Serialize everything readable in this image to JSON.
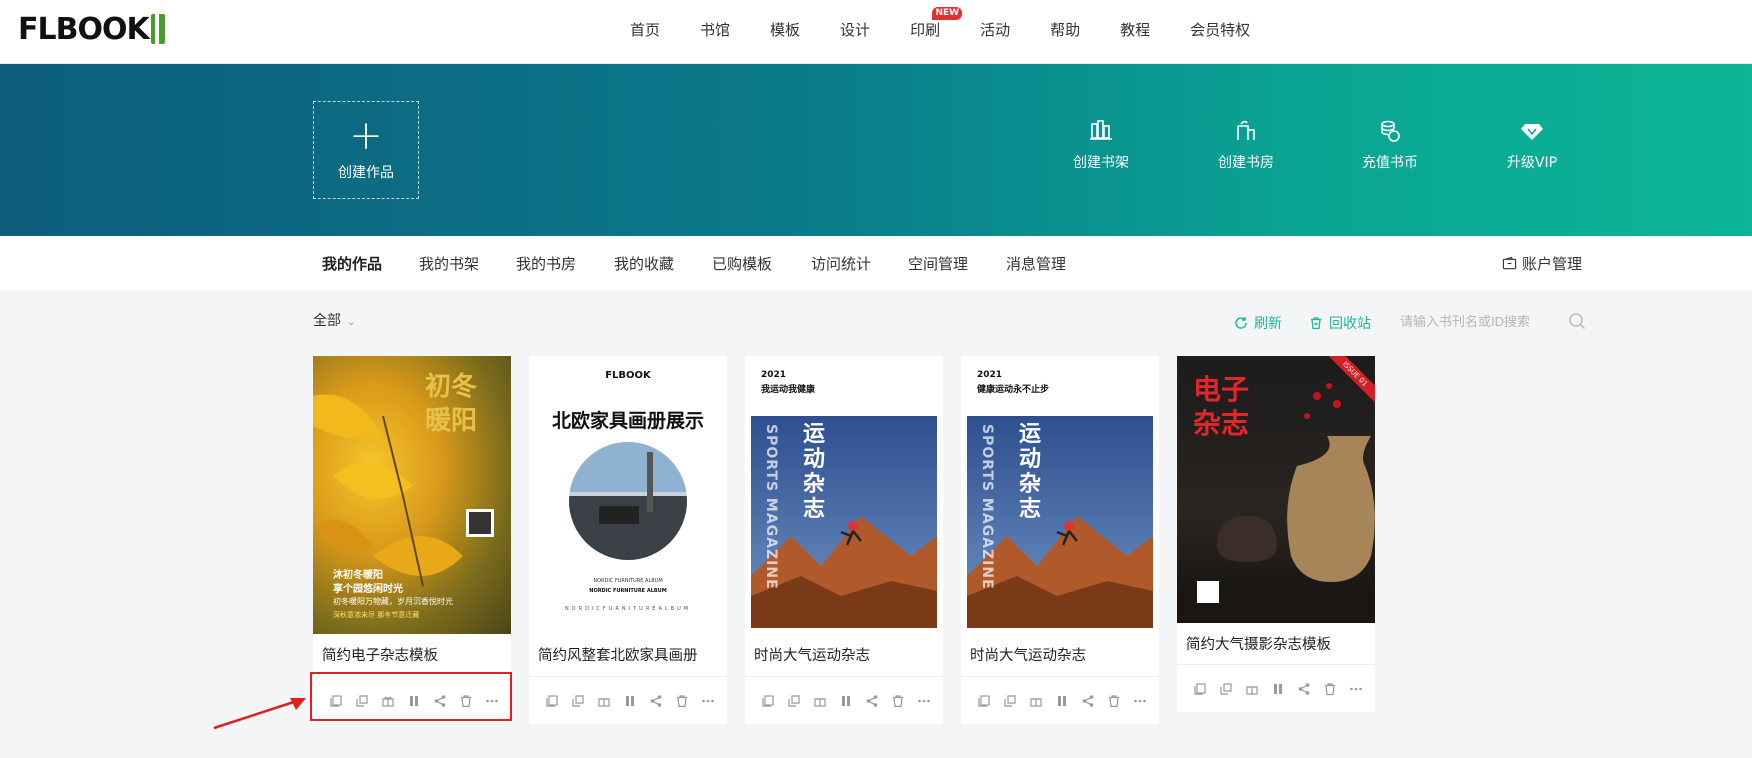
{
  "nav": {
    "logo": "FLBOOK",
    "links": [
      "首页",
      "书馆",
      "模板",
      "设计",
      "印刷",
      "活动",
      "帮助",
      "教程",
      "会员特权"
    ],
    "new_badge": "NEW"
  },
  "banner": {
    "create_label": "创建作品",
    "actions": [
      "创建书架",
      "创建书房",
      "充值书币",
      "升级VIP"
    ]
  },
  "subnav": {
    "tabs": [
      "我的作品",
      "我的书架",
      "我的书房",
      "我的收藏",
      "已购模板",
      "访问统计",
      "空间管理",
      "消息管理"
    ],
    "account": "账户管理"
  },
  "toolbar": {
    "filter": "全部",
    "refresh": "刷新",
    "recycle": "回收站",
    "search_placeholder": "请输入书刊名或ID搜索"
  },
  "cards": [
    {
      "title": "简约电子杂志模板",
      "cover": {
        "big": "初冬暖阳",
        "line1": "沐初冬暖阳",
        "line2": "享个园悠闲时光",
        "line3": "初冬暖阳万物藏，岁月沉香悦时光",
        "line4": "深秋意浓未尽  那冬节意迁藏"
      }
    },
    {
      "title": "简约风整套北欧家具画册",
      "cover": {
        "logo": "FLBOOK",
        "heading": "北欧家具画册展示",
        "sub1": "NORDIC FURNITURE ALBUM",
        "sub2": "NORDIC FURNITURE ALBUM",
        "sub3": "NORDICFURNITUREALBUM"
      }
    },
    {
      "title": "时尚大气运动杂志",
      "cover": {
        "year": "2021",
        "heading": "我运动我健康",
        "vertical_en": "SPORTS MAGAZINE",
        "vertical_cn": "运动杂志"
      }
    },
    {
      "title": "时尚大气运动杂志",
      "cover": {
        "year": "2021",
        "heading": "健康运动永不止步",
        "vertical_en": "SPORTS MAGAZINE",
        "vertical_cn": "运动杂志"
      }
    },
    {
      "title": "简约大气摄影杂志模板",
      "cover": {
        "heading1": "电子",
        "heading2": "杂志",
        "ribbon": "ISSUE 01"
      }
    }
  ],
  "tool_icons": [
    "copy-icon",
    "edit-icon",
    "gift-icon",
    "pause-icon",
    "share-icon",
    "delete-icon",
    "more-icon"
  ],
  "colors": {
    "accent": "#1fb59a",
    "banner_start": "#0d5d7d",
    "banner_end": "#0cb596",
    "highlight": "#e02020"
  }
}
